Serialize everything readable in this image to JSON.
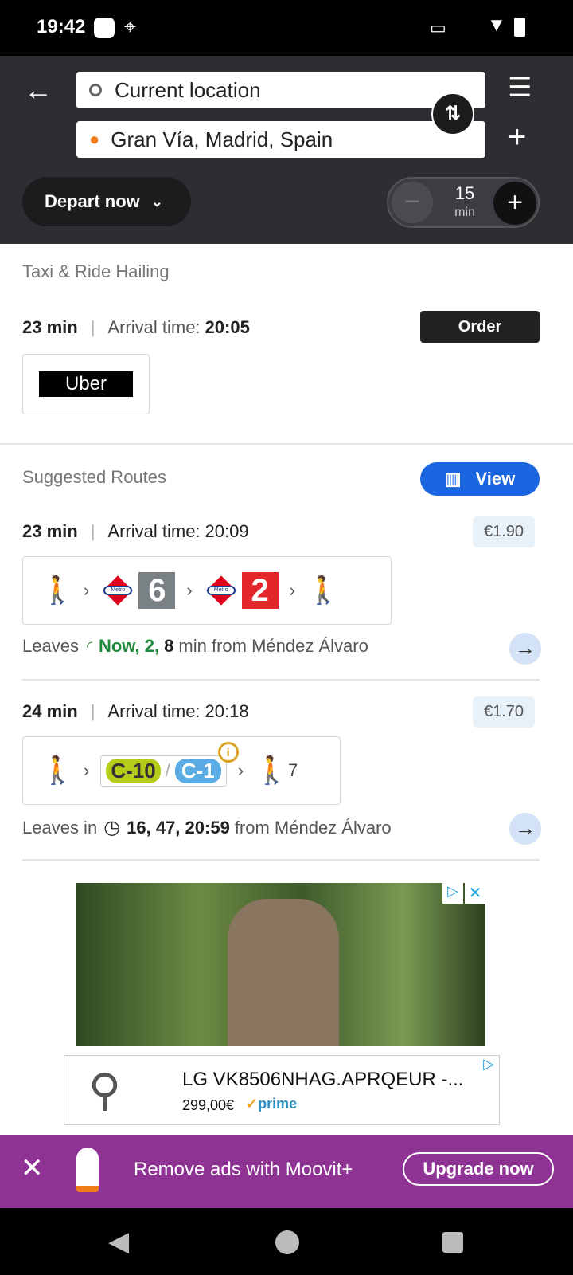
{
  "status_bar": {
    "time": "19:42"
  },
  "search": {
    "origin": "Current location",
    "destination": "Gran Vía, Madrid, Spain"
  },
  "depart": {
    "label": "Depart now"
  },
  "stepper": {
    "value": "15",
    "unit": "min"
  },
  "taxi": {
    "section_title": "Taxi & Ride Hailing",
    "duration": "23 min",
    "arrival_label": "Arrival time:",
    "arrival": "20:05",
    "order_label": "Order",
    "provider": "Uber"
  },
  "routes": {
    "section_title": "Suggested Routes",
    "view_label": "View",
    "items": [
      {
        "duration": "23 min",
        "arrival_label": "Arrival time:",
        "arrival": "20:09",
        "price": "€1.90",
        "lines": [
          "6",
          "2"
        ],
        "leaves_label": "Leaves",
        "realtime": "Now, 2,",
        "next": "8",
        "suffix": "min from Méndez Álvaro"
      },
      {
        "duration": "24 min",
        "arrival_label": "Arrival time:",
        "arrival": "20:18",
        "price": "€1.70",
        "lines": [
          "C-10",
          "C-1"
        ],
        "walk_min": "7",
        "leaves_label": "Leaves in",
        "times": "16, 47, 20:59",
        "suffix": "from Méndez Álvaro"
      }
    ]
  },
  "ad": {
    "product": "LG VK8506NHAG.APRQEUR -...",
    "price": "299,00€",
    "badge": "prime"
  },
  "promo": {
    "text": "Remove ads with Moovit+",
    "button": "Upgrade now"
  },
  "colors": {
    "header": "#2d2e32",
    "accent": "#1a66e0",
    "promo": "#8e3394",
    "realtime": "#1f8a3e",
    "line6": "#7a8185",
    "line2": "#e3262b",
    "c10": "#b5cc18",
    "c1": "#5aace4"
  }
}
